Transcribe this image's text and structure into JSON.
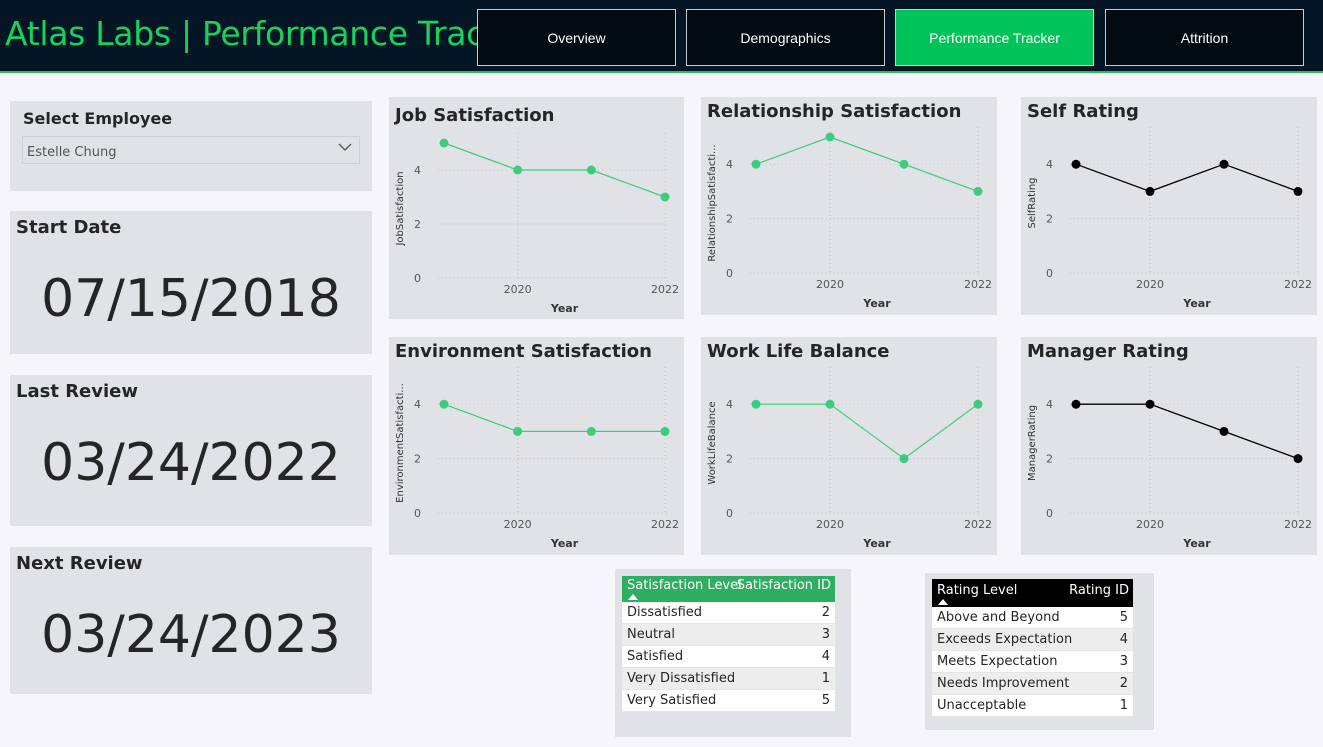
{
  "header": {
    "title": "Atlas Labs | Performance Tracker",
    "tabs": [
      {
        "label": "Overview",
        "active": false
      },
      {
        "label": "Demographics",
        "active": false
      },
      {
        "label": "Performance Tracker",
        "active": true
      },
      {
        "label": "Attrition",
        "active": false
      }
    ],
    "accent_color": "#16d35c"
  },
  "slicer": {
    "label": "Select Employee",
    "value": "Estelle Chung"
  },
  "dates": {
    "start": {
      "label": "Start Date",
      "value": "07/15/2018"
    },
    "last_review": {
      "label": "Last Review",
      "value": "03/24/2022"
    },
    "next_review": {
      "label": "Next Review",
      "value": "03/24/2023"
    }
  },
  "chart_data": [
    {
      "id": "job",
      "type": "line",
      "title": "Job Satisfaction",
      "xlabel": "Year",
      "ylabel": "JobSatisfaction",
      "x": [
        2019,
        2020,
        2021,
        2022
      ],
      "values": [
        5,
        4,
        4,
        3
      ],
      "ylim": [
        0,
        5
      ],
      "yticks": [
        0,
        2,
        4
      ],
      "xticks": [
        2020,
        2022
      ],
      "color": "#3dcc7e"
    },
    {
      "id": "rel",
      "type": "line",
      "title": "Relationship Satisfaction",
      "xlabel": "Year",
      "ylabel": "RelationshipSatisfacti...",
      "x": [
        2019,
        2020,
        2021,
        2022
      ],
      "values": [
        4,
        5,
        4,
        3
      ],
      "ylim": [
        0,
        5
      ],
      "yticks": [
        0,
        2,
        4
      ],
      "xticks": [
        2020,
        2022
      ],
      "color": "#3dcc7e"
    },
    {
      "id": "self",
      "type": "line",
      "title": "Self Rating",
      "xlabel": "Year",
      "ylabel": "SelfRating",
      "x": [
        2019,
        2020,
        2021,
        2022
      ],
      "values": [
        4,
        3,
        4,
        3
      ],
      "ylim": [
        0,
        5
      ],
      "yticks": [
        0,
        2,
        4
      ],
      "xticks": [
        2020,
        2022
      ],
      "color": "#000000"
    },
    {
      "id": "env",
      "type": "line",
      "title": "Environment Satisfaction",
      "xlabel": "Year",
      "ylabel": "EnvironmentSatisfacti...",
      "x": [
        2019,
        2020,
        2021,
        2022
      ],
      "values": [
        4,
        3,
        3,
        3
      ],
      "ylim": [
        0,
        5
      ],
      "yticks": [
        0,
        2,
        4
      ],
      "xticks": [
        2020,
        2022
      ],
      "color": "#3dcc7e"
    },
    {
      "id": "wlb",
      "type": "line",
      "title": "Work Life Balance",
      "xlabel": "Year",
      "ylabel": "WorkLifeBalance",
      "x": [
        2019,
        2020,
        2021,
        2022
      ],
      "values": [
        4,
        4,
        2,
        4
      ],
      "ylim": [
        0,
        5
      ],
      "yticks": [
        0,
        2,
        4
      ],
      "xticks": [
        2020,
        2022
      ],
      "color": "#3dcc7e"
    },
    {
      "id": "mgr",
      "type": "line",
      "title": "Manager Rating",
      "xlabel": "Year",
      "ylabel": "ManagerRating",
      "x": [
        2019,
        2020,
        2021,
        2022
      ],
      "values": [
        4,
        4,
        3,
        2
      ],
      "ylim": [
        0,
        5
      ],
      "yticks": [
        0,
        2,
        4
      ],
      "xticks": [
        2020,
        2022
      ],
      "color": "#000000"
    }
  ],
  "satisfaction_table": {
    "header_color": "#2fae61",
    "columns": [
      "Satisfaction Level",
      "Satisfaction ID"
    ],
    "rows": [
      [
        "Dissatisfied",
        "2"
      ],
      [
        "Neutral",
        "3"
      ],
      [
        "Satisfied",
        "4"
      ],
      [
        "Very Dissatisfied",
        "1"
      ],
      [
        "Very Satisfied",
        "5"
      ]
    ]
  },
  "rating_table": {
    "header_color": "#000000",
    "columns": [
      "Rating Level",
      "Rating ID"
    ],
    "rows": [
      [
        "Above and Beyond",
        "5"
      ],
      [
        "Exceeds Expectation",
        "4"
      ],
      [
        "Meets Expectation",
        "3"
      ],
      [
        "Needs Improvement",
        "2"
      ],
      [
        "Unacceptable",
        "1"
      ]
    ]
  }
}
